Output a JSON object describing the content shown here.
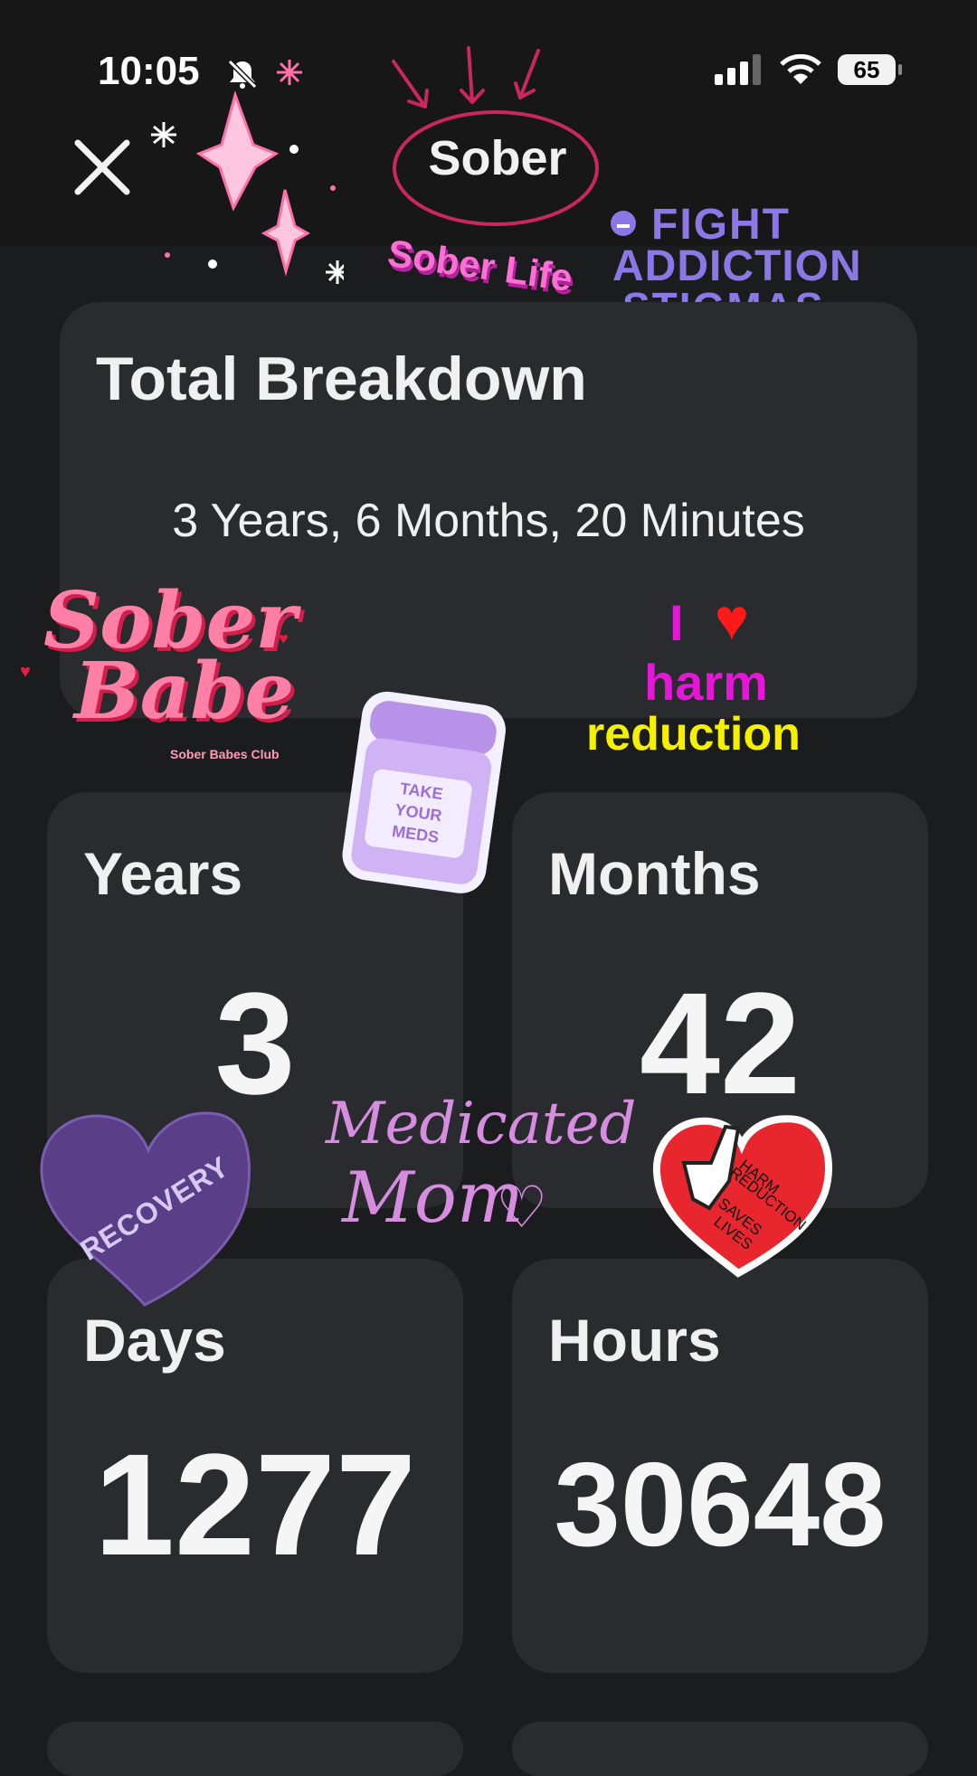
{
  "status_bar": {
    "time": "10:05",
    "battery": "65"
  },
  "header": {
    "title": "Sober"
  },
  "breakdown": {
    "title": "Total Breakdown",
    "text": "3 Years, 6 Months, 20 Minutes"
  },
  "cards": {
    "years": {
      "label": "Years",
      "value": "3"
    },
    "months": {
      "label": "Months",
      "value": "42"
    },
    "days": {
      "label": "Days",
      "value": "1277"
    },
    "hours": {
      "label": "Hours",
      "value": "30648"
    }
  },
  "stickers": {
    "sober_life": "Sober Life",
    "fight_line1": "FIGHT",
    "fight_line2": "ADDICTION",
    "fight_line3": "STIGMAS",
    "sober_babe_line1": "Sober",
    "sober_babe_line2": "Babe",
    "sober_babes_club": "Sober Babes Club",
    "i_love": "I",
    "harm": "harm",
    "reduction": "reduction",
    "take": "TAKE",
    "your": "YOUR",
    "meds": "MEDS",
    "recovery": "RECOVERY",
    "medicated_line1": "Medicated",
    "medicated_line2": "Mom",
    "harm_red_1": "HARM",
    "harm_red_2": "REDUCTION",
    "harm_red_3": "SAVES",
    "harm_red_4": "LIVES"
  },
  "colors": {
    "background": "#1b1c1e",
    "card": "#2a2b2e",
    "accent_pink": "#ff6fa8",
    "accent_purple": "#8b78e6"
  }
}
